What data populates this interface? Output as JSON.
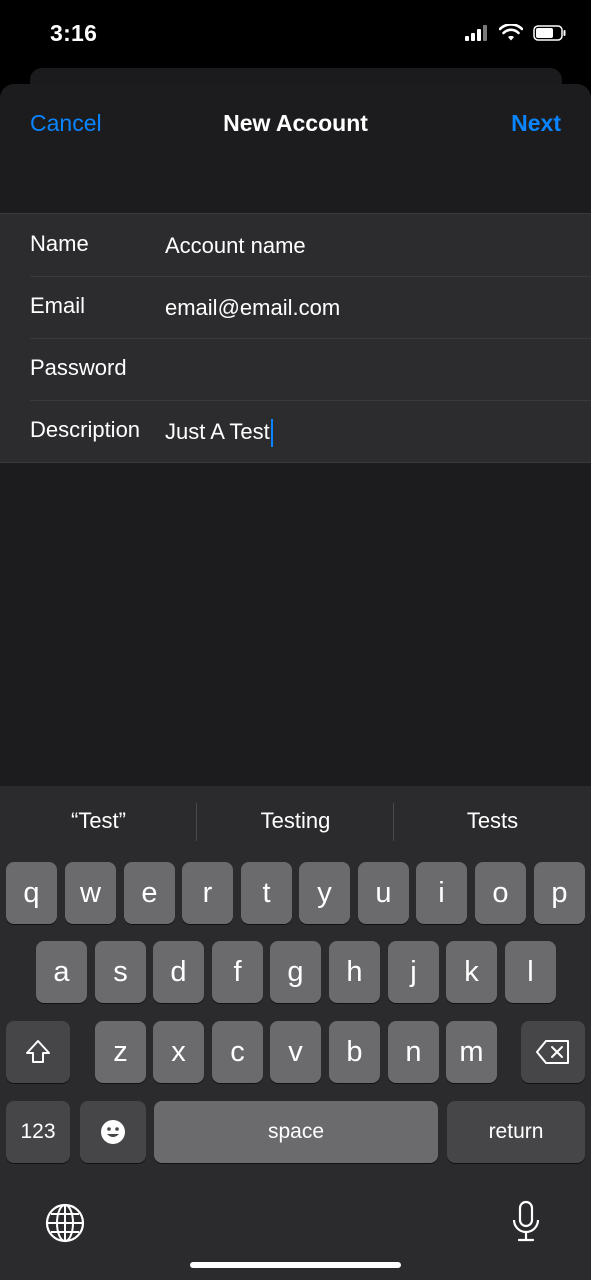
{
  "status_bar": {
    "time": "3:16"
  },
  "nav": {
    "cancel": "Cancel",
    "title": "New Account",
    "next": "Next"
  },
  "form": {
    "rows": [
      {
        "label": "Name",
        "value": "Account name"
      },
      {
        "label": "Email",
        "value": "email@email.com"
      },
      {
        "label": "Password",
        "value": ""
      },
      {
        "label": "Description",
        "value": "Just A Test"
      }
    ]
  },
  "keyboard": {
    "suggestions": [
      "“Test”",
      "Testing",
      "Tests"
    ],
    "row1": [
      "q",
      "w",
      "e",
      "r",
      "t",
      "y",
      "u",
      "i",
      "o",
      "p"
    ],
    "row2": [
      "a",
      "s",
      "d",
      "f",
      "g",
      "h",
      "j",
      "k",
      "l"
    ],
    "row3": [
      "z",
      "x",
      "c",
      "v",
      "b",
      "n",
      "m"
    ],
    "numbers_key": "123",
    "space_key": "space",
    "return_key": "return"
  },
  "colors": {
    "accent": "#0a84ff",
    "sheet_bg": "#1c1c1e",
    "row_bg": "#2c2c2e",
    "key_bg": "#6b6b6e",
    "key_dark": "#464649"
  }
}
